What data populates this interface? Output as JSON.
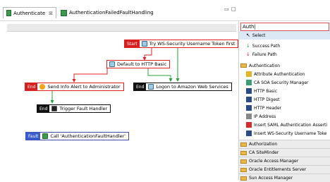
{
  "tabs": {
    "active": "Authenticate",
    "close": "⊠",
    "inactive": "AuthenticationFailedFaultHandling"
  },
  "window_controls": {
    "minimize": "▭",
    "maximize": "□"
  },
  "nodes": {
    "start": {
      "tag": "Start",
      "label": "Try WS-Security Username Token first"
    },
    "default": {
      "label": "Default to HTTP Basic"
    },
    "send": {
      "tag": "End",
      "label": "Send Info Alert to Administrator"
    },
    "logon": {
      "tag": "End",
      "label": "Logon to Amazon Web Services"
    },
    "trigger": {
      "tag": "End",
      "label": "Trigger Fault Handler"
    },
    "fault": {
      "tag": "Fault",
      "label": "Call 'AuthenticationFaultHandler'"
    }
  },
  "palette": {
    "search_value": "Auth|",
    "select": "Select",
    "success_path": "Success Path",
    "failure_path": "Failure Path",
    "cat_authentication": "Authentication",
    "items": [
      "Attribute Authentication",
      "CA SOA Security Manager",
      "HTTP Basic",
      "HTTP Digest",
      "HTTP Header",
      "IP Address",
      "Insert SAML Authentication Asserti",
      "Insert WS-Security Username Toke"
    ],
    "categories": [
      "Authorization",
      "CA SiteMinder",
      "Oracle Access Manager",
      "Oracle Entitlements Server",
      "Sun Access Manager"
    ]
  }
}
